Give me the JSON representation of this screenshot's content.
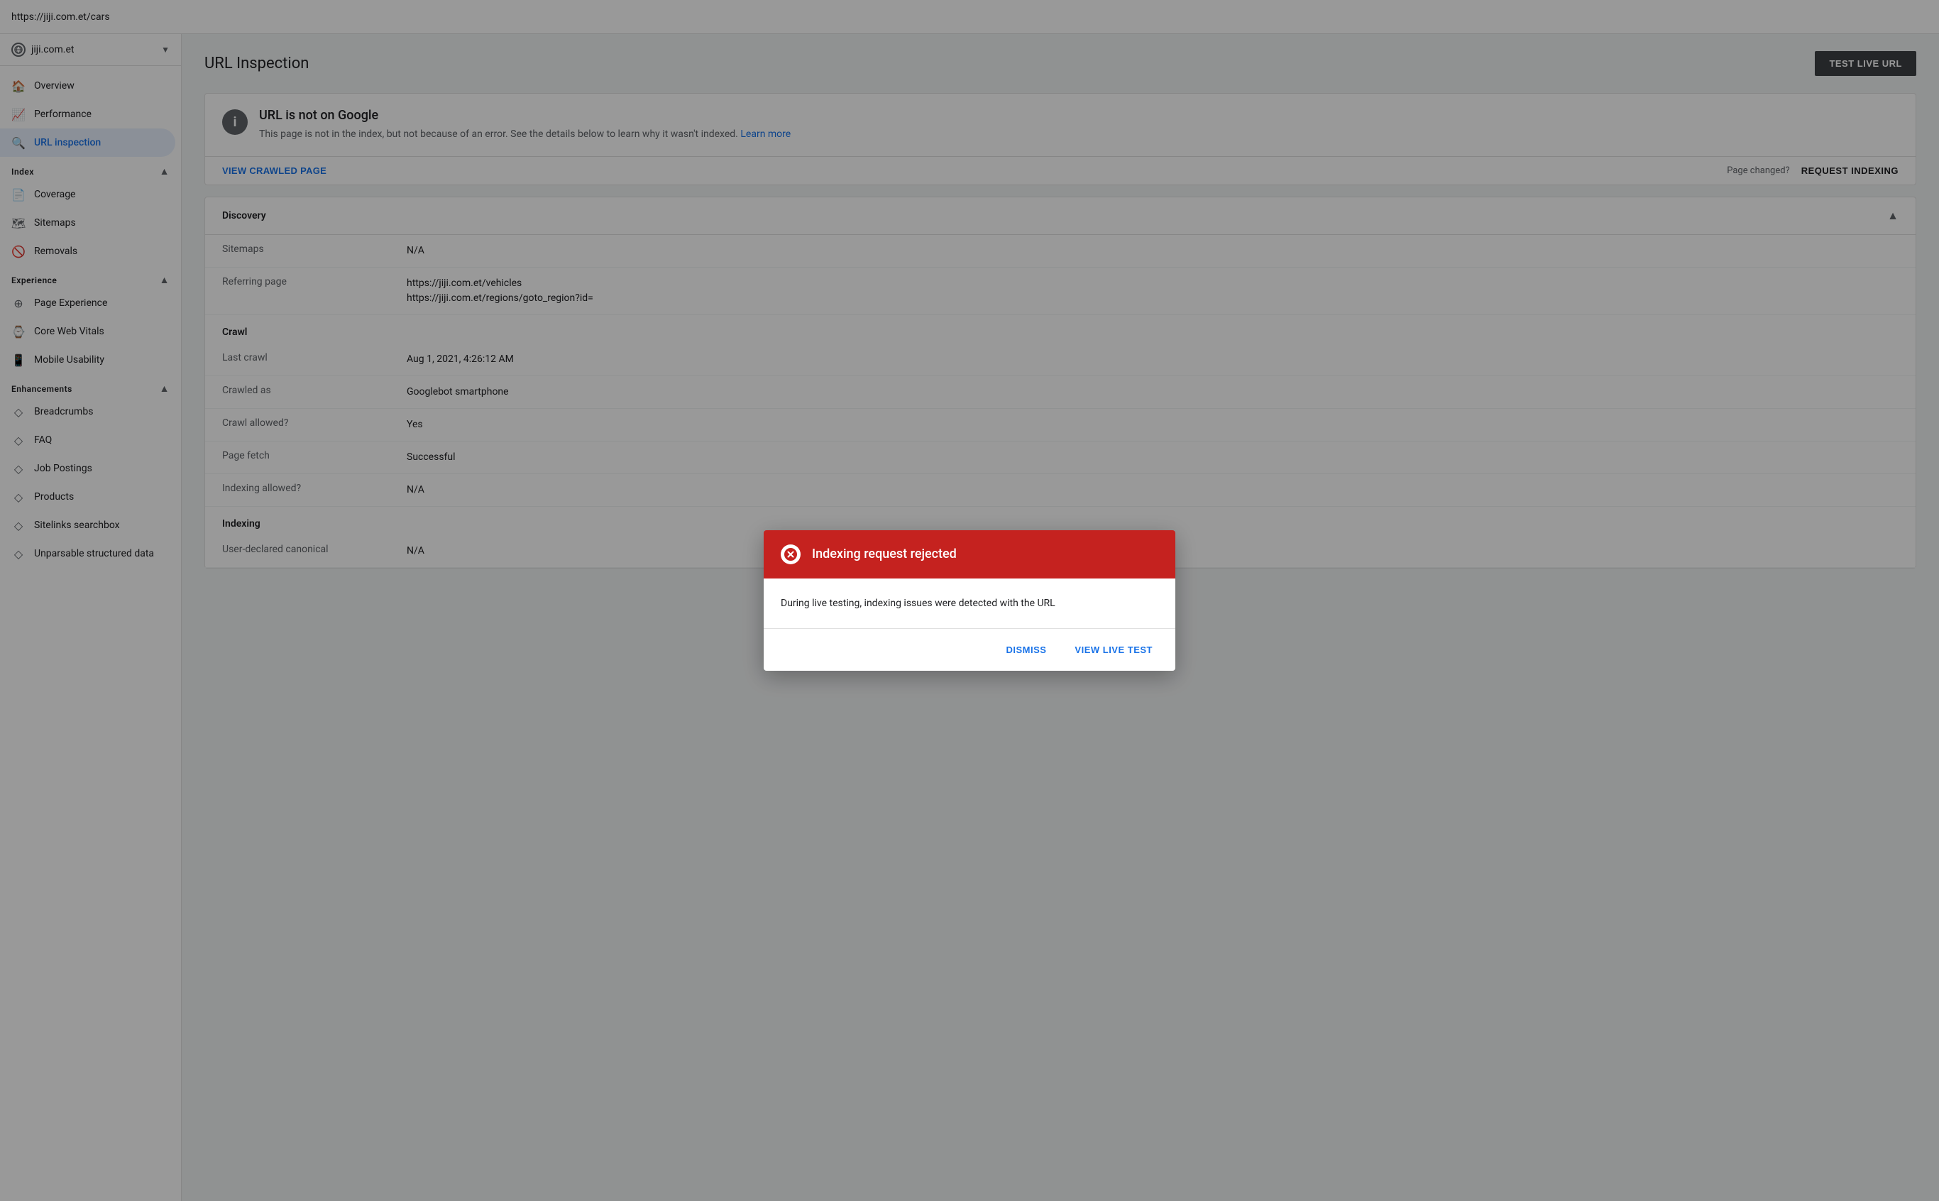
{
  "topbar": {
    "url": "https://jiji.com.et/cars"
  },
  "sidebar": {
    "property_name": "jiji.com.et",
    "nav_items": [
      {
        "id": "overview",
        "label": "Overview",
        "icon": "🏠"
      },
      {
        "id": "performance",
        "label": "Performance",
        "icon": "📈"
      },
      {
        "id": "url-inspection",
        "label": "URL inspection",
        "icon": "🔍",
        "active": true
      }
    ],
    "sections": [
      {
        "id": "index",
        "label": "Index",
        "expanded": true,
        "items": [
          {
            "id": "coverage",
            "label": "Coverage",
            "icon": "📄"
          },
          {
            "id": "sitemaps",
            "label": "Sitemaps",
            "icon": "🗺"
          },
          {
            "id": "removals",
            "label": "Removals",
            "icon": "🚫"
          }
        ]
      },
      {
        "id": "experience",
        "label": "Experience",
        "expanded": true,
        "items": [
          {
            "id": "page-experience",
            "label": "Page Experience",
            "icon": "⊕"
          },
          {
            "id": "core-web-vitals",
            "label": "Core Web Vitals",
            "icon": "⌚"
          },
          {
            "id": "mobile-usability",
            "label": "Mobile Usability",
            "icon": "📱"
          }
        ]
      },
      {
        "id": "enhancements",
        "label": "Enhancements",
        "expanded": true,
        "items": [
          {
            "id": "breadcrumbs",
            "label": "Breadcrumbs",
            "icon": "◇"
          },
          {
            "id": "faq",
            "label": "FAQ",
            "icon": "◇"
          },
          {
            "id": "job-postings",
            "label": "Job Postings",
            "icon": "◇"
          },
          {
            "id": "products",
            "label": "Products",
            "icon": "◇"
          },
          {
            "id": "sitelinks-searchbox",
            "label": "Sitelinks searchbox",
            "icon": "◇"
          },
          {
            "id": "unparsable-structured-data",
            "label": "Unparsable structured data",
            "icon": "◇"
          }
        ]
      }
    ]
  },
  "page": {
    "title": "URL Inspection",
    "test_live_btn": "TEST LIVE URL"
  },
  "info_card": {
    "icon": "i",
    "title": "URL is not on Google",
    "description": "This page is not in the index, but not because of an error. See the details below to learn why it wasn't indexed.",
    "learn_more": "Learn more",
    "view_crawled_page": "VIEW CRAWLED PAGE",
    "page_changed_label": "Page changed?",
    "request_indexing_btn": "REQUEST INDEXING"
  },
  "details": {
    "discovery_section": "Discovery",
    "rows": [
      {
        "label": "Sitemaps",
        "value": "N/A"
      },
      {
        "label": "Referring page",
        "value": "https://jiji.com.et/vehicles\nhttps://jiji.com.et/regions/goto_region?id="
      }
    ],
    "crawl_section": "Crawl",
    "crawl_rows": [
      {
        "label": "Last crawl",
        "value": "Aug 1, 2021, 4:26:12 AM"
      },
      {
        "label": "Crawled as",
        "value": "Googlebot smartphone"
      },
      {
        "label": "Crawl allowed?",
        "value": "Yes"
      },
      {
        "label": "Page fetch",
        "value": "Successful"
      },
      {
        "label": "Indexing allowed?",
        "value": "N/A"
      }
    ],
    "indexing_section": "Indexing",
    "indexing_rows": [
      {
        "label": "User-declared canonical",
        "value": "N/A"
      }
    ]
  },
  "modal": {
    "title": "Indexing request rejected",
    "body": "During live testing, indexing issues were detected with the URL",
    "dismiss_btn": "DISMISS",
    "view_live_test_btn": "VIEW LIVE TEST"
  }
}
